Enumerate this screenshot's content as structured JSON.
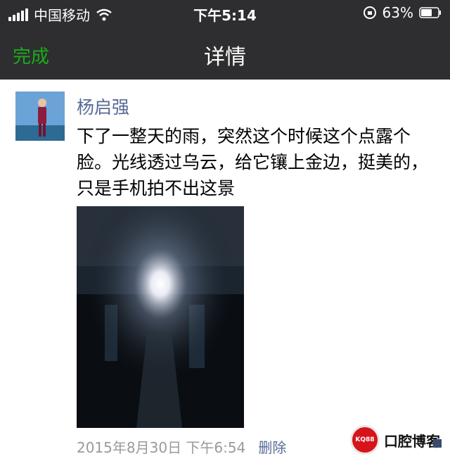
{
  "status_bar": {
    "carrier": "中国移动",
    "time": "下午5:14",
    "battery": "63%",
    "icons": [
      "signal-icon",
      "wifi-icon",
      "rotation-lock-icon",
      "battery-icon"
    ]
  },
  "nav": {
    "done_label": "完成",
    "title": "详情"
  },
  "post": {
    "author": "杨启强",
    "text": "下了一整天的雨，突然这个时候这个点露个脸。光线透过乌云，给它镶上金边，挺美的，只是手机拍不出这景",
    "timestamp": "2015年8月30日 下午6:54",
    "delete_label": "删除"
  },
  "watermark": {
    "badge": "KQ88",
    "text": "口腔博客"
  },
  "colors": {
    "header_bg": "#2e2e30",
    "done_green": "#1aad19",
    "link_blue": "#576b95",
    "timestamp_gray": "#9a9a9a"
  }
}
